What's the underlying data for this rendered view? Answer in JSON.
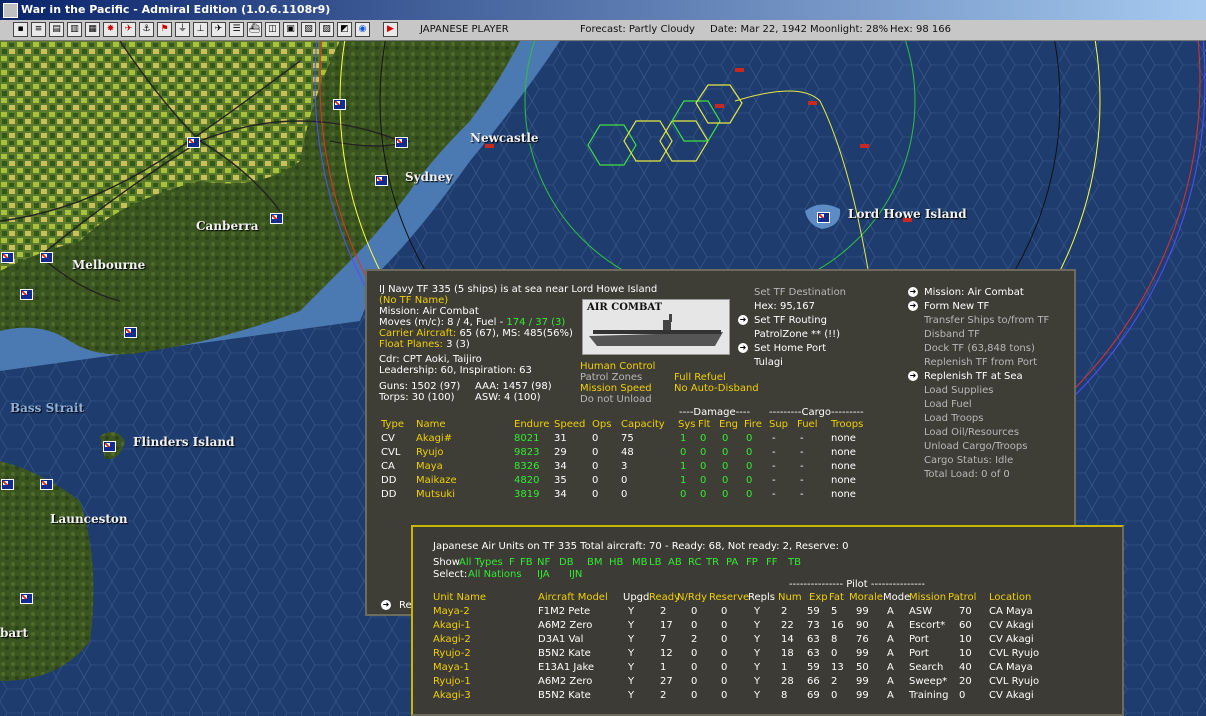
{
  "window": {
    "title": "War in the Pacific - Admiral Edition (1.0.6.1108r9)"
  },
  "toolbar": {
    "player": "JAPANESE PLAYER",
    "forecast": "Forecast: Partly Cloudy",
    "date": "Date: Mar 22, 1942",
    "moonlight": "Moonlight: 28%",
    "hex": "Hex: 98 166"
  },
  "map_labels": {
    "newcastle": "Newcastle",
    "sydney": "Sydney",
    "canberra": "Canberra",
    "melbourne": "Melbourne",
    "lord_howe": "Lord Howe Island",
    "bass_strait": "Bass Strait",
    "flinders": "Flinders Island",
    "launceston": "Launceston",
    "hobart": "bart"
  },
  "tf": {
    "header": "IJ Navy TF 335 (5 ships) is at sea near Lord Howe Island",
    "name": "(No TF Name)",
    "mission": "Mission: Air Combat",
    "moves_prefix": "Moves (m/c): 8 / 4, Fuel - ",
    "moves_fuel": "174 / 37 (3)",
    "carrier_label": "Carrier Aircraft:",
    "carrier_value": " 65 (67), MS: 485(56%)",
    "float_label": "Float Planes:",
    "float_value": " 3 (3)",
    "cdr": "Cdr: CPT Aoki, Taijiro",
    "leadership": "Leadership: 60, Inspiration: 63",
    "guns": "Guns: 1502 (97)",
    "aaa": "AAA: 1457 (98)",
    "torps": "Torps: 30 (100)",
    "asw": "ASW: 4 (100)",
    "mission_banner": "AIR COMBAT",
    "options": {
      "human_control": "Human Control",
      "patrol_zones": "Patrol Zones",
      "mission_speed": "Mission Speed",
      "no_unload": "Do not Unload",
      "full_refuel": "Full Refuel",
      "no_auto_disband": "No Auto-Disband"
    },
    "dest": {
      "set_dest": "Set TF Destination",
      "hex": "Hex: 95,167",
      "set_routing": "Set TF Routing",
      "patrol": "PatrolZone ** (!!)",
      "set_home": "Set Home Port",
      "home": "Tulagi"
    },
    "commands": {
      "mission": "Mission: Air Combat",
      "form_new": "Form New TF",
      "transfer": "Transfer Ships to/from TF",
      "disband": "Disband TF",
      "dock": "Dock TF (63,848 tons)",
      "replenish_port": "Replenish TF from Port",
      "replenish_sea": "Replenish TF at Sea",
      "load_supplies": "Load Supplies",
      "load_fuel": "Load Fuel",
      "load_troops": "Load Troops",
      "load_oil": "Load Oil/Resources",
      "unload": "Unload Cargo/Troops",
      "cargo_status": "Cargo Status: Idle",
      "total_load": "Total Load: 0 of 0"
    },
    "group_headers": {
      "damage": "----Damage----",
      "cargo": "---------Cargo---------"
    },
    "columns": {
      "type": "Type",
      "name": "Name",
      "endure": "Endure",
      "speed": "Speed",
      "ops": "Ops",
      "capacity": "Capacity",
      "sys": "Sys",
      "flt": "Flt",
      "eng": "Eng",
      "fire": "Fire",
      "sup": "Sup",
      "fuel": "Fuel",
      "troops": "Troops"
    },
    "ships": [
      {
        "type": "CV",
        "name": "Akagi#",
        "endure": "8021",
        "speed": "31",
        "ops": "0",
        "capacity": "75",
        "sys": "1",
        "flt": "0",
        "eng": "0",
        "fire": "0",
        "sup": "-",
        "fuel": "-",
        "troops": "none"
      },
      {
        "type": "CVL",
        "name": "Ryujo",
        "endure": "9823",
        "speed": "29",
        "ops": "0",
        "capacity": "48",
        "sys": "0",
        "flt": "0",
        "eng": "0",
        "fire": "0",
        "sup": "-",
        "fuel": "-",
        "troops": "none"
      },
      {
        "type": "CA",
        "name": "Maya",
        "endure": "8326",
        "speed": "34",
        "ops": "0",
        "capacity": "3",
        "sys": "1",
        "flt": "0",
        "eng": "0",
        "fire": "0",
        "sup": "-",
        "fuel": "-",
        "troops": "none"
      },
      {
        "type": "DD",
        "name": "Maikaze",
        "endure": "4820",
        "speed": "35",
        "ops": "0",
        "capacity": "0",
        "sys": "1",
        "flt": "0",
        "eng": "0",
        "fire": "0",
        "sup": "-",
        "fuel": "-",
        "troops": "none"
      },
      {
        "type": "DD",
        "name": "Mutsuki",
        "endure": "3819",
        "speed": "34",
        "ops": "0",
        "capacity": "0",
        "sys": "0",
        "flt": "0",
        "eng": "0",
        "fire": "0",
        "sup": "-",
        "fuel": "-",
        "troops": "none"
      }
    ],
    "return_label": "Re"
  },
  "air": {
    "header": "Japanese Air Units on TF 335 Total aircraft: 70 - Ready: 68, Not ready: 2, Reserve: 0",
    "show_label": "Show",
    "select_label": "Select:",
    "show_types": [
      "All Types",
      "F",
      "FB",
      "NF",
      "DB",
      "BM",
      "HB",
      "MB",
      "LB",
      "AB",
      "RC",
      "TR",
      "PA",
      "FP",
      "FF",
      "TB"
    ],
    "select_items": [
      "All Nations",
      "IJA",
      "IJN"
    ],
    "pilot_header": "--------------- Pilot ---------------",
    "columns": {
      "unit": "Unit Name",
      "model": "Aircraft Model",
      "upgd": "Upgd",
      "ready": "Ready",
      "nrdy": "N/Rdy",
      "reserve": "Reserve",
      "repls": "Repls",
      "num": "Num",
      "exp": "Exp",
      "fat": "Fat",
      "morale": "Morale",
      "mode": "Mode",
      "mission": "Mission",
      "patrol": "Patrol",
      "location": "Location"
    },
    "units": [
      {
        "unit": "Maya-2",
        "model": "F1M2 Pete",
        "upgd": "Y",
        "ready": "2",
        "nrdy": "0",
        "reserve": "0",
        "repls": "Y",
        "num": "2",
        "exp": "59",
        "fat": "5",
        "morale": "99",
        "mode": "A",
        "mission": "ASW",
        "patrol": "70",
        "location": "CA Maya"
      },
      {
        "unit": "Akagi-1",
        "model": "A6M2 Zero",
        "upgd": "Y",
        "ready": "17",
        "nrdy": "0",
        "reserve": "0",
        "repls": "Y",
        "num": "22",
        "exp": "73",
        "fat": "16",
        "morale": "90",
        "mode": "A",
        "mission": "Escort*",
        "patrol": "60",
        "location": "CV Akagi"
      },
      {
        "unit": "Akagi-2",
        "model": "D3A1 Val",
        "upgd": "Y",
        "ready": "7",
        "nrdy": "2",
        "reserve": "0",
        "repls": "Y",
        "num": "14",
        "exp": "63",
        "fat": "8",
        "morale": "76",
        "mode": "A",
        "mission": "Port",
        "patrol": "10",
        "location": "CV Akagi"
      },
      {
        "unit": "Ryujo-2",
        "model": "B5N2 Kate",
        "upgd": "Y",
        "ready": "12",
        "nrdy": "0",
        "reserve": "0",
        "repls": "Y",
        "num": "18",
        "exp": "63",
        "fat": "0",
        "morale": "99",
        "mode": "A",
        "mission": "Port",
        "patrol": "10",
        "location": "CVL Ryujo"
      },
      {
        "unit": "Maya-1",
        "model": "E13A1 Jake",
        "upgd": "Y",
        "ready": "1",
        "nrdy": "0",
        "reserve": "0",
        "repls": "Y",
        "num": "1",
        "exp": "59",
        "fat": "13",
        "morale": "50",
        "mode": "A",
        "mission": "Search",
        "patrol": "40",
        "location": "CA Maya"
      },
      {
        "unit": "Ryujo-1",
        "model": "A6M2 Zero",
        "upgd": "Y",
        "ready": "27",
        "nrdy": "0",
        "reserve": "0",
        "repls": "Y",
        "num": "28",
        "exp": "66",
        "fat": "2",
        "morale": "99",
        "mode": "A",
        "mission": "Sweep*",
        "patrol": "20",
        "location": "CVL Ryujo"
      },
      {
        "unit": "Akagi-3",
        "model": "B5N2 Kate",
        "upgd": "Y",
        "ready": "2",
        "nrdy": "0",
        "reserve": "0",
        "repls": "Y",
        "num": "8",
        "exp": "69",
        "fat": "0",
        "morale": "99",
        "mode": "A",
        "mission": "Training",
        "patrol": "0",
        "location": "CV Akagi"
      }
    ]
  },
  "colors": {
    "panel": "#3e3d36",
    "highlight_yellow": "#f0d000",
    "highlight_green": "#34ea34",
    "sea": "#1e3d6e",
    "land": "#4c6a24"
  },
  "icons": [
    "window-icon",
    "toolbar-icons",
    "flag-icon",
    "ship-icon",
    "arrow-icon"
  ]
}
